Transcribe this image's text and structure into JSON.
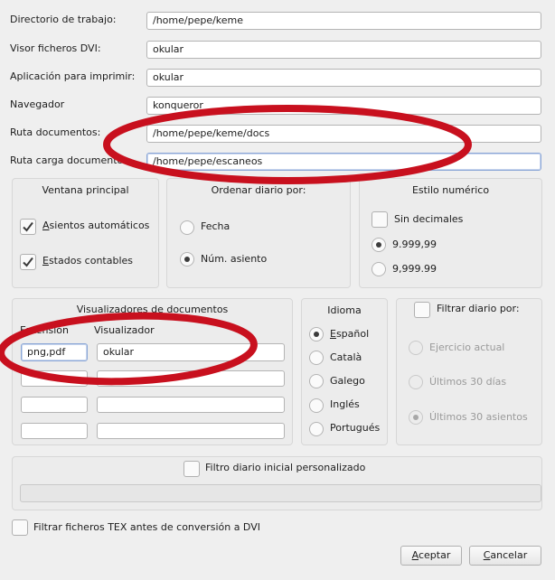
{
  "settings": {
    "rows": [
      {
        "label": "Directorio de trabajo:",
        "value": "/home/pepe/keme"
      },
      {
        "label": "Visor ficheros DVI:",
        "value": "okular"
      },
      {
        "label": "Aplicación para imprimir:",
        "value": "okular"
      },
      {
        "label": "Navegador",
        "value": "konqueror"
      },
      {
        "label": "Ruta documentos:",
        "value": "/home/pepe/keme/docs"
      },
      {
        "label": "Ruta carga documentos:",
        "value": "/home/pepe/escaneos"
      }
    ]
  },
  "ventana": {
    "title": "Ventana principal",
    "items": [
      {
        "label_u": "A",
        "label_rest": "sientos automáticos",
        "checked": true
      },
      {
        "label_u": "E",
        "label_rest": "stados contables",
        "checked": true
      }
    ]
  },
  "ordenar": {
    "title": "Ordenar diario por:",
    "options": [
      {
        "label": "Fecha",
        "selected": false
      },
      {
        "label": "Núm. asiento",
        "selected": true
      }
    ]
  },
  "estilo": {
    "title": "Estilo numérico",
    "checkbox_label": "Sin decimales",
    "options": [
      {
        "label": "9.999,99",
        "selected": true
      },
      {
        "label": "9,999.99",
        "selected": false
      }
    ]
  },
  "visualizadores": {
    "title": "Visualizadores de documentos",
    "col_extension": "Extensión",
    "col_viewer": "Visualizador",
    "rows": [
      {
        "extension": "png,pdf",
        "viewer": "okular"
      },
      {
        "extension": "",
        "viewer": ""
      },
      {
        "extension": "",
        "viewer": ""
      },
      {
        "extension": "",
        "viewer": ""
      }
    ]
  },
  "idioma": {
    "title": "Idioma",
    "options": [
      {
        "label_u": "E",
        "label_rest": "spañol",
        "selected": true
      },
      {
        "label_u": "",
        "label_rest": "Català",
        "selected": false
      },
      {
        "label_u": "",
        "label_rest": "Galego",
        "selected": false
      },
      {
        "label_u": "",
        "label_rest": "Inglés",
        "selected": false
      },
      {
        "label_u": "",
        "label_rest": "Portugués",
        "selected": false
      }
    ]
  },
  "filtrar": {
    "title": "Filtrar diario por:",
    "checked": false,
    "options": [
      {
        "label": "Ejercicio actual",
        "selected": false
      },
      {
        "label": "Últimos 30 días",
        "selected": false
      },
      {
        "label": "Últimos 30 asientos",
        "selected": true
      }
    ]
  },
  "filtro_inicial": {
    "label": "Filtro diario inicial personalizado",
    "value": ""
  },
  "tex_filter": {
    "label": "Filtrar ficheros TEX antes de conversión a DVI"
  },
  "buttons": {
    "accept_u": "A",
    "accept_rest": "ceptar",
    "cancel_u": "C",
    "cancel_rest": "ancelar"
  },
  "colors": {
    "annotation": "#c8101e",
    "focus_border": "#8aa6d6"
  }
}
